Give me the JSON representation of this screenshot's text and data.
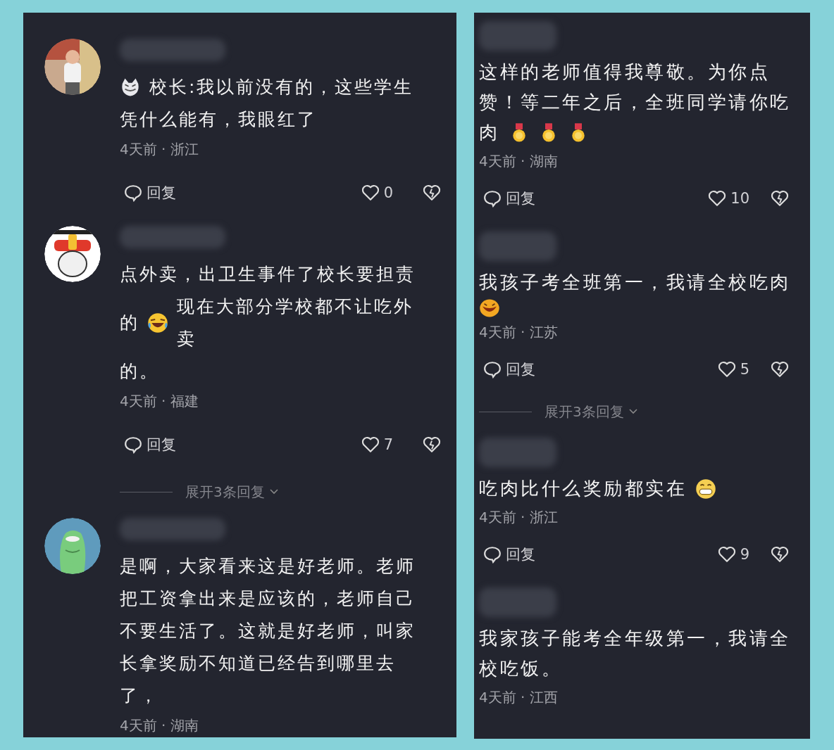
{
  "panels": [
    {
      "comments": [
        {
          "avatar": {
            "kind": "picture"
          },
          "lines": [
            [
              {
                "kind": "emoji"
              },
              {
                "kind": "text",
                "text": "校长:我以前没有的，这些学生"
              }
            ],
            [
              {
                "kind": "text",
                "text": "凭什么能有，我眼红了"
              }
            ]
          ],
          "meta": "4天前 · 浙江",
          "reply": "回复",
          "likes": "0",
          "liked": false
        },
        {
          "avatar": {
            "kind": "picture"
          },
          "lines": [
            [
              {
                "kind": "text",
                "text": "点外卖，出卫生事件了校长要担责"
              }
            ],
            [
              {
                "kind": "text",
                "text": "的"
              },
              {
                "kind": "emoji"
              },
              {
                "kind": "text",
                "text": "现在大部分学校都不让吃外卖"
              }
            ],
            [
              {
                "kind": "text",
                "text": "的。"
              }
            ]
          ],
          "meta": "4天前 · 福建",
          "reply": "回复",
          "likes": "7",
          "liked": false,
          "expand": "展开3条回复"
        },
        {
          "avatar": {
            "kind": "picture"
          },
          "lines": [
            [
              {
                "kind": "text",
                "text": "是啊，大家看来这是好老师。老师把工资拿出来是应该的，老师自己不要生活了。这就是好老师，叫家长拿奖励不知道已经告到哪里去了，"
              }
            ]
          ],
          "meta": "4天前 · 湖南"
        }
      ]
    },
    {
      "comments": [
        {
          "lines": [
            [
              {
                "kind": "text",
                "text": "这样的老师值得我尊敬。为你点赞！等二年之后，全班同学请你吃"
              }
            ],
            [
              {
                "kind": "text",
                "text": "肉"
              },
              {
                "kind": "emoji"
              },
              {
                "kind": "emoji"
              },
              {
                "kind": "emoji"
              }
            ]
          ],
          "meta": "4天前 · 湖南",
          "reply": "回复",
          "likes": "10",
          "liked": false
        },
        {
          "lines": [
            [
              {
                "kind": "text",
                "text": "我孩子考全班第一，我请全校吃肉"
              }
            ],
            [
              {
                "kind": "emoji"
              }
            ]
          ],
          "meta": "4天前 · 江苏",
          "reply": "回复",
          "likes": "5",
          "liked": false,
          "expand": "展开3条回复"
        },
        {
          "lines": [
            [
              {
                "kind": "text",
                "text": "吃肉比什么奖励都实在"
              },
              {
                "kind": "emoji"
              }
            ]
          ],
          "meta": "4天前 · 浙江",
          "reply": "回复",
          "likes": "9",
          "liked": false
        },
        {
          "lines": [
            [
              {
                "kind": "text",
                "text": "我家孩子能考全年级第一，我请全校吃饭。"
              }
            ]
          ],
          "meta": "4天前 · 江西"
        }
      ]
    }
  ]
}
